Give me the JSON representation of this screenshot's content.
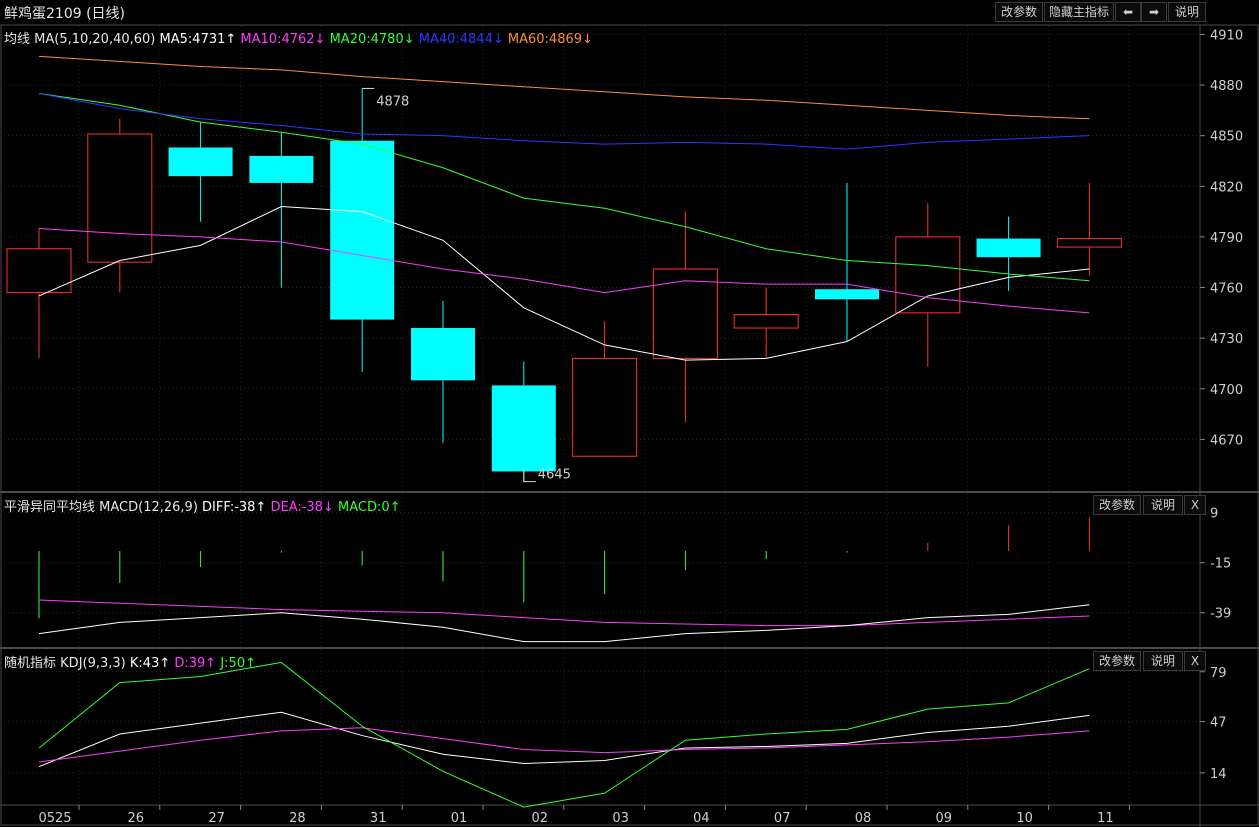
{
  "header": {
    "title": "鲜鸡蛋2109 (日线)",
    "buttons": [
      "改参数",
      "隐藏主指标",
      "⬅",
      "➡",
      "说明"
    ]
  },
  "ma_legend": {
    "name": "均线",
    "params": "MA(5,10,20,40,60)",
    "items": [
      {
        "label": "MA5:4731↑",
        "color": "#ffffff"
      },
      {
        "label": "MA10:4762↓",
        "color": "#ff3cff"
      },
      {
        "label": "MA20:4780↓",
        "color": "#33ff33"
      },
      {
        "label": "MA40:4844↓",
        "color": "#3333ff"
      },
      {
        "label": "MA60:4869↓",
        "color": "#ff8c3a"
      }
    ]
  },
  "macd_legend": {
    "name": "平滑异同平均线",
    "params": "MACD(12,26,9)",
    "items": [
      {
        "label": "DIFF:-38↑",
        "color": "#ffffff"
      },
      {
        "label": "DEA:-38↓",
        "color": "#ff3cff"
      },
      {
        "label": "MACD:0↑",
        "color": "#33ff33"
      }
    ],
    "buttons": [
      "改参数",
      "说明",
      "X"
    ]
  },
  "kdj_legend": {
    "name": "随机指标",
    "params": "KDJ(9,3,3)",
    "items": [
      {
        "label": "K:43↑",
        "color": "#ffffff"
      },
      {
        "label": "D:39↑",
        "color": "#ff3cff"
      },
      {
        "label": "J:50↑",
        "color": "#33ff33"
      }
    ],
    "buttons": [
      "改参数",
      "说明",
      "X"
    ]
  },
  "colors": {
    "up": "#ff3030",
    "down": "#00ffff",
    "grid": "#262626",
    "border": "#4a4a4a"
  },
  "chart_data": [
    {
      "type": "candlestick",
      "categories": [
        "0525",
        "26",
        "27",
        "28",
        "31",
        "01",
        "02",
        "03",
        "04",
        "07",
        "08",
        "09",
        "10",
        "11"
      ],
      "candles": [
        {
          "open": 4757,
          "close": 4783,
          "high": 4795,
          "low": 4718
        },
        {
          "open": 4775,
          "close": 4851,
          "high": 4860,
          "low": 4757
        },
        {
          "open": 4843,
          "close": 4826,
          "high": 4858,
          "low": 4799
        },
        {
          "open": 4838,
          "close": 4822,
          "high": 4852,
          "low": 4760
        },
        {
          "open": 4847,
          "close": 4741,
          "high": 4878,
          "low": 4710
        },
        {
          "open": 4736,
          "close": 4705,
          "high": 4752,
          "low": 4668
        },
        {
          "open": 4702,
          "close": 4651,
          "high": 4716,
          "low": 4645
        },
        {
          "open": 4660,
          "close": 4718,
          "high": 4740,
          "low": 4660
        },
        {
          "open": 4718,
          "close": 4771,
          "high": 4805,
          "low": 4680
        },
        {
          "open": 4736,
          "close": 4744,
          "high": 4760,
          "low": 4718
        },
        {
          "open": 4759,
          "close": 4753,
          "high": 4822,
          "low": 4728
        },
        {
          "open": 4745,
          "close": 4790,
          "high": 4810,
          "low": 4713
        },
        {
          "open": 4789,
          "close": 4778,
          "high": 4802,
          "low": 4758
        },
        {
          "open": 4784,
          "close": 4789,
          "high": 4822,
          "low": 4767
        }
      ],
      "series": [
        {
          "name": "MA5",
          "values": [
            4755,
            4776,
            4785,
            4808,
            4805,
            4788,
            4748,
            4726,
            4717,
            4718,
            4728,
            4755,
            4766,
            4771
          ]
        },
        {
          "name": "MA10",
          "values": [
            4795,
            4792,
            4790,
            4787,
            4779,
            4771,
            4765,
            4757,
            4764,
            4762,
            4762,
            4754,
            4749,
            4745
          ]
        },
        {
          "name": "MA20",
          "values": [
            4875,
            4868,
            4858,
            4852,
            4845,
            4831,
            4813,
            4807,
            4796,
            4783,
            4776,
            4773,
            4768,
            4764
          ]
        },
        {
          "name": "MA40",
          "values": [
            4875,
            4866,
            4860,
            4856,
            4851,
            4850,
            4847,
            4845,
            4846,
            4845,
            4842,
            4846,
            4848,
            4850
          ]
        },
        {
          "name": "MA60",
          "values": [
            4897,
            4894,
            4891,
            4889,
            4885,
            4882,
            4879,
            4876,
            4873,
            4871,
            4868,
            4865,
            4862,
            4860
          ]
        }
      ],
      "annotations": [
        {
          "label": "4878"
        },
        {
          "label": "4645"
        }
      ],
      "yticks": [
        4910,
        4880,
        4850,
        4820,
        4790,
        4760,
        4730,
        4700,
        4670
      ],
      "ylim": [
        4640,
        4915
      ]
    },
    {
      "type": "bar",
      "categories": [
        "0525",
        "26",
        "27",
        "28",
        "31",
        "01",
        "02",
        "03",
        "04",
        "07",
        "08",
        "09",
        "10",
        "11"
      ],
      "macd": [
        -42,
        -20,
        -10,
        -1,
        -9,
        -19,
        -32,
        -27,
        -12,
        -5,
        -1,
        5,
        16,
        21
      ],
      "diff": [
        -50,
        -43,
        -40,
        -37,
        -41,
        -46,
        -55,
        -55,
        -50,
        -48,
        -45,
        -40,
        -38,
        -32
      ],
      "dea": [
        -29,
        -31,
        -33,
        -35,
        -36,
        -37,
        -40,
        -43,
        -44,
        -45,
        -45,
        -43,
        -41,
        -39
      ],
      "yticks": [
        9,
        -15,
        -39
      ],
      "ylim": [
        -55,
        18
      ]
    },
    {
      "type": "line",
      "categories": [
        "0525",
        "26",
        "27",
        "28",
        "31",
        "01",
        "02",
        "03",
        "04",
        "07",
        "08",
        "09",
        "10",
        "11"
      ],
      "series": [
        {
          "name": "K",
          "values": [
            18,
            39,
            46,
            53,
            38,
            26,
            20,
            22,
            30,
            31,
            33,
            40,
            44,
            51
          ]
        },
        {
          "name": "D",
          "values": [
            21,
            28,
            35,
            41,
            43,
            36,
            29,
            27,
            29,
            30,
            32,
            34,
            37,
            41
          ]
        },
        {
          "name": "J",
          "values": [
            30,
            72,
            76,
            85,
            44,
            15,
            -8,
            1,
            35,
            39,
            42,
            55,
            59,
            81
          ]
        }
      ],
      "yticks": [
        79,
        47,
        14
      ],
      "ylim": [
        -6,
        93
      ]
    }
  ]
}
